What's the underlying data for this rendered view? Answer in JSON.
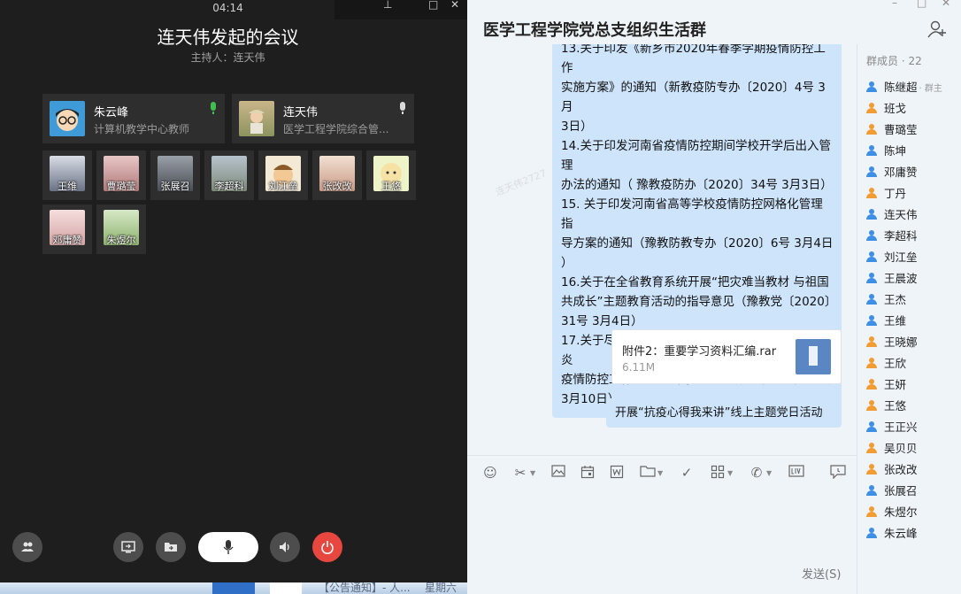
{
  "meeting": {
    "timer": "04:14",
    "title": "连天伟发起的会议",
    "host_label": "主持人：",
    "host_name": "连天伟",
    "featured": [
      {
        "name": "朱云峰",
        "role": "计算机教学中心教师",
        "mic_color": "#3fbf4b"
      },
      {
        "name": "连天伟",
        "role": "医学工程学院综合管...",
        "mic_color": "#d8d8d8"
      }
    ],
    "participants": [
      "王维",
      "曹璐莹",
      "张展召",
      "李超科",
      "刘江垒",
      "张改改",
      "王悠",
      "邓庸赞",
      "朱煜尔"
    ],
    "controls": {
      "members": "members-icon",
      "share_screen": "share-screen-icon",
      "share_file": "share-file-icon",
      "mic": "microphone-icon",
      "speaker": "speaker-icon",
      "hangup": "power-icon"
    },
    "colors": {
      "background": "#1e1e1e",
      "card": "#2e2e2e",
      "hangup": "#e8473f"
    }
  },
  "taskbar": {
    "notice": "【公告通知】- 人...",
    "day": "星期六"
  },
  "chat": {
    "title": "医学工程学院党总支组织生活群",
    "watermark": "连天伟2727",
    "message_lines": [
      "13.关于印发《新乡市2020年春季学期疫情防控工作",
      "实施方案》的通知（新教疫防专办〔2020〕4号  3月",
      "3日）",
      "14.关于印发河南省疫情防控期间学校开学后出入管理",
      "办法的通知（  豫教疫防办〔2020〕34号  3月3日）",
      "15. 关于印发河南省高等学校疫情防控网格化管理指",
      "导方案的通知（豫教防教专办〔2020〕6号  3月4日",
      "）",
      "16.关于在全省教育系统开展“把灾难当教材 与祖国",
      "共成长”主题教育活动的指导意见（豫教党〔2020〕",
      "31号  3月4日）",
      "17.关于尽快组织人员返岗进一步加强开学前新冠肺炎",
      "疫情防控工作的通知（豫教防教专办〔2020〕11号",
      "3月10日）"
    ],
    "file": {
      "name": "附件2：重要学习资料汇编.rar",
      "size": "6.11M"
    },
    "last_message": "开展“抗疫心得我来讲”线上主题党日活动",
    "send_label": "发送(S)",
    "toolbar_icons": [
      "emoji-icon",
      "scissors-icon",
      "image-icon",
      "calendar-icon",
      "word-doc-icon",
      "folder-icon",
      "check-icon",
      "apps-icon",
      "phone-icon",
      "live-icon",
      "chat-history-icon"
    ],
    "colors": {
      "bubble": "#cde4fb",
      "background": "#eff4f8",
      "member_icon": "#3d8ee6",
      "owner_icon": "#f39c34"
    }
  },
  "members": {
    "label": "群成员",
    "count": "· 22",
    "list": [
      {
        "name": "陈继超",
        "badge": "· 群主",
        "icon_color": "#3d8ee6"
      },
      {
        "name": "班戈",
        "badge": "",
        "icon_color": "#f39c34"
      },
      {
        "name": "曹璐莹",
        "badge": "",
        "icon_color": "#f39c34"
      },
      {
        "name": "陈坤",
        "badge": "",
        "icon_color": "#3d8ee6"
      },
      {
        "name": "邓庸赞",
        "badge": "",
        "icon_color": "#3d8ee6"
      },
      {
        "name": "丁丹",
        "badge": "",
        "icon_color": "#f39c34"
      },
      {
        "name": "连天伟",
        "badge": "",
        "icon_color": "#3d8ee6"
      },
      {
        "name": "李超科",
        "badge": "",
        "icon_color": "#3d8ee6"
      },
      {
        "name": "刘江垒",
        "badge": "",
        "icon_color": "#3d8ee6"
      },
      {
        "name": "王晨波",
        "badge": "",
        "icon_color": "#3d8ee6"
      },
      {
        "name": "王杰",
        "badge": "",
        "icon_color": "#3d8ee6"
      },
      {
        "name": "王维",
        "badge": "",
        "icon_color": "#3d8ee6"
      },
      {
        "name": "王晓娜",
        "badge": "",
        "icon_color": "#f39c34"
      },
      {
        "name": "王欣",
        "badge": "",
        "icon_color": "#f39c34"
      },
      {
        "name": "王妍",
        "badge": "",
        "icon_color": "#f39c34"
      },
      {
        "name": "王悠",
        "badge": "",
        "icon_color": "#f39c34"
      },
      {
        "name": "王正兴",
        "badge": "",
        "icon_color": "#3d8ee6"
      },
      {
        "name": "吴贝贝",
        "badge": "",
        "icon_color": "#f39c34"
      },
      {
        "name": "张改改",
        "badge": "",
        "icon_color": "#f39c34"
      },
      {
        "name": "张展召",
        "badge": "",
        "icon_color": "#3d8ee6"
      },
      {
        "name": "朱煜尔",
        "badge": "",
        "icon_color": "#f39c34"
      },
      {
        "name": "朱云峰",
        "badge": "",
        "icon_color": "#3d8ee6"
      }
    ]
  }
}
